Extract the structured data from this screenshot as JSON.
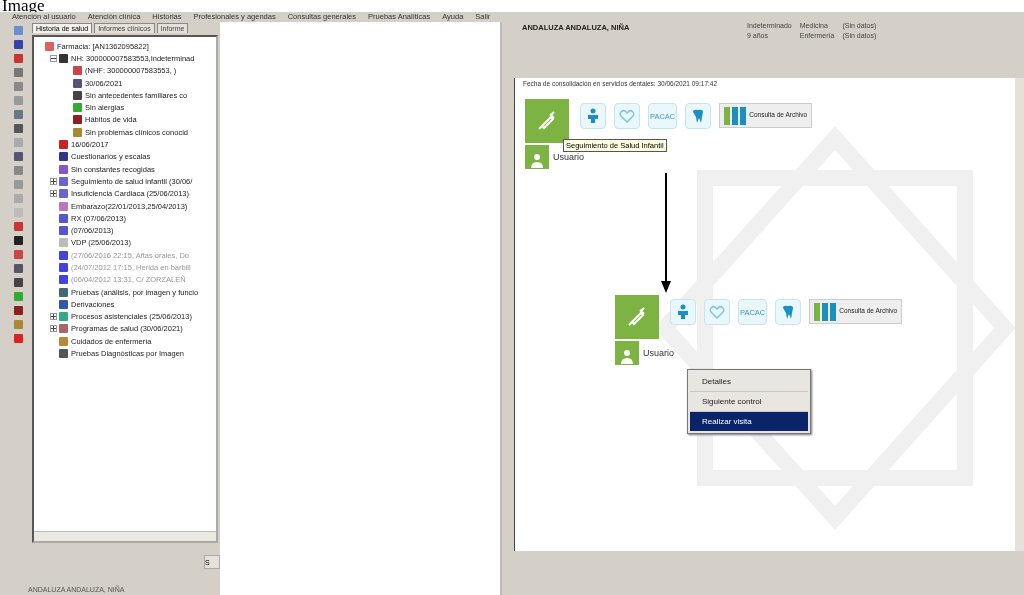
{
  "caption": "Image",
  "menu": [
    "Atención al usuario",
    "Atención clínica",
    "Historias",
    "Profesionales y agendas",
    "Consultas generales",
    "Pruebas Analíticas",
    "Ayuda",
    "Salir"
  ],
  "tabs": [
    {
      "label": "Historia de salud",
      "selected": true
    },
    {
      "label": "Informes clínicos",
      "selected": false
    },
    {
      "label": "Informe",
      "selected": false
    }
  ],
  "tree": {
    "label": "Farmacia: [AN1362095822]",
    "kind": "pharmacy",
    "children": [
      {
        "label": "NH: 300000007583553,Indeterminad",
        "kind": "person",
        "expanded": true,
        "disabled": false,
        "children": [
          {
            "label": "(NHF: 300000007583553, )",
            "kind": "home"
          },
          {
            "label": "30/06/2021",
            "kind": "calendar"
          },
          {
            "label": "Sin antecedentes familiares co",
            "kind": "family"
          },
          {
            "label": "Sin alergias",
            "kind": "allergy"
          },
          {
            "label": "Hábitos de vida",
            "kind": "habits"
          },
          {
            "label": "Sin problemas clínicos conocid",
            "kind": "problems"
          }
        ]
      },
      {
        "label": "16/06/2017",
        "kind": "vaccine",
        "disabled": false
      },
      {
        "label": "Cuestionarios y escalas",
        "kind": "form",
        "disabled": false
      },
      {
        "label": "Sin constantes recogidas",
        "kind": "vitals",
        "disabled": false
      },
      {
        "label": "Seguimiento de salud infantil (30/06/",
        "kind": "child",
        "expanded": false,
        "disabled": false
      },
      {
        "label": "Insuficiencia Cardiaca (25/06/2013)",
        "kind": "child",
        "expanded": false,
        "disabled": false
      },
      {
        "label": "Embarazo(22/01/2013,25/04/2013)",
        "kind": "pregnancy",
        "disabled": false
      },
      {
        "label": "RX (07/06/2013)",
        "kind": "xray",
        "disabled": false
      },
      {
        "label": "(07/06/2013)",
        "kind": "xray",
        "disabled": false
      },
      {
        "label": "VDP (25/06/2013)",
        "kind": "vdp",
        "disabled": false
      },
      {
        "label": "(27/06/2016 22:15, Aftas orales, Do",
        "kind": "visit",
        "disabled": true
      },
      {
        "label": "(24/07/2012 17:15, Herida en barbill",
        "kind": "visit",
        "disabled": true
      },
      {
        "label": "(06/04/2012 13:31, C/ ZORZALEÑ",
        "kind": "visit",
        "disabled": true
      },
      {
        "label": "Pruebas (análisis, por imagen y funcio",
        "kind": "tests",
        "disabled": false
      },
      {
        "label": "Derivaciones",
        "kind": "referral",
        "disabled": false
      },
      {
        "label": "Procesos asistenciales (25/06/2013)",
        "kind": "process",
        "expanded": false,
        "disabled": false
      },
      {
        "label": "Programas de salud (30/06/2021)",
        "kind": "program",
        "expanded": false,
        "disabled": false
      },
      {
        "label": "Cuidados de enfermería",
        "kind": "nursing",
        "disabled": false
      },
      {
        "label": "Pruebas Diagnósticas por Imagen",
        "kind": "imaging",
        "disabled": false
      }
    ]
  },
  "bottom": {
    "patient": "ANDALUZA ANDALUZA, NIÑA",
    "button": "S"
  },
  "header": {
    "patient": "ANDALUZA ANDALUZA, NIÑA",
    "sex": "Indeterminado",
    "age": "9 años",
    "staff": [
      {
        "role": "Medicina",
        "value": "(Sin datos)"
      },
      {
        "role": "Enfermería",
        "value": "(Sin datos)"
      }
    ]
  },
  "content": {
    "date_line": "Fecha de consolidación en servicios dentales: 30/06/2021 09:17:42",
    "groups": [
      {
        "user": "Usuario",
        "pacac": "PACAC",
        "archive": "Consulta de Archivo",
        "tooltip": "Seguimiento de Salud Infantil"
      },
      {
        "user": "Usuario",
        "pacac": "PACAC",
        "archive": "Consulta de Archivo",
        "menu": [
          {
            "label": "Detalles",
            "selected": false
          },
          {
            "label": "Siguiente control",
            "selected": false
          },
          {
            "label": "Realizar visita",
            "selected": true
          }
        ]
      }
    ]
  }
}
